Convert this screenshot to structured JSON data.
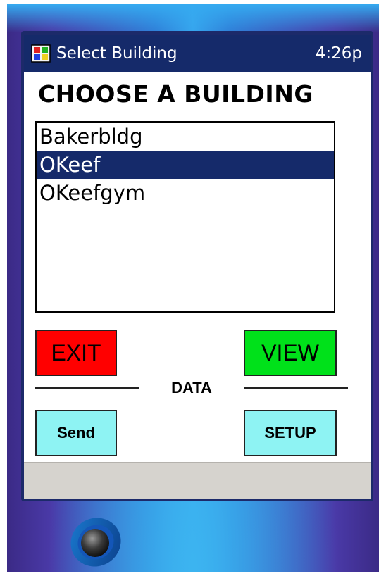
{
  "titlebar": {
    "icon": "windows-flag-start-icon",
    "title": "Select Building",
    "clock": "4:26p"
  },
  "heading": "CHOOSE A BUILDING",
  "buildings": {
    "items": [
      "Bakerbldg",
      "OKeef",
      "OKeefgym"
    ],
    "selected": "OKeef"
  },
  "buttons": {
    "exit": "EXIT",
    "view": "VIEW",
    "send": "Send",
    "setup": "SETUP"
  },
  "data_section": {
    "label": "DATA"
  },
  "colors": {
    "titlebar": "#152a6a",
    "selection": "#152a6a",
    "exit": "#ff0000",
    "view": "#00e11a",
    "data_buttons": "#8ef3f3"
  }
}
